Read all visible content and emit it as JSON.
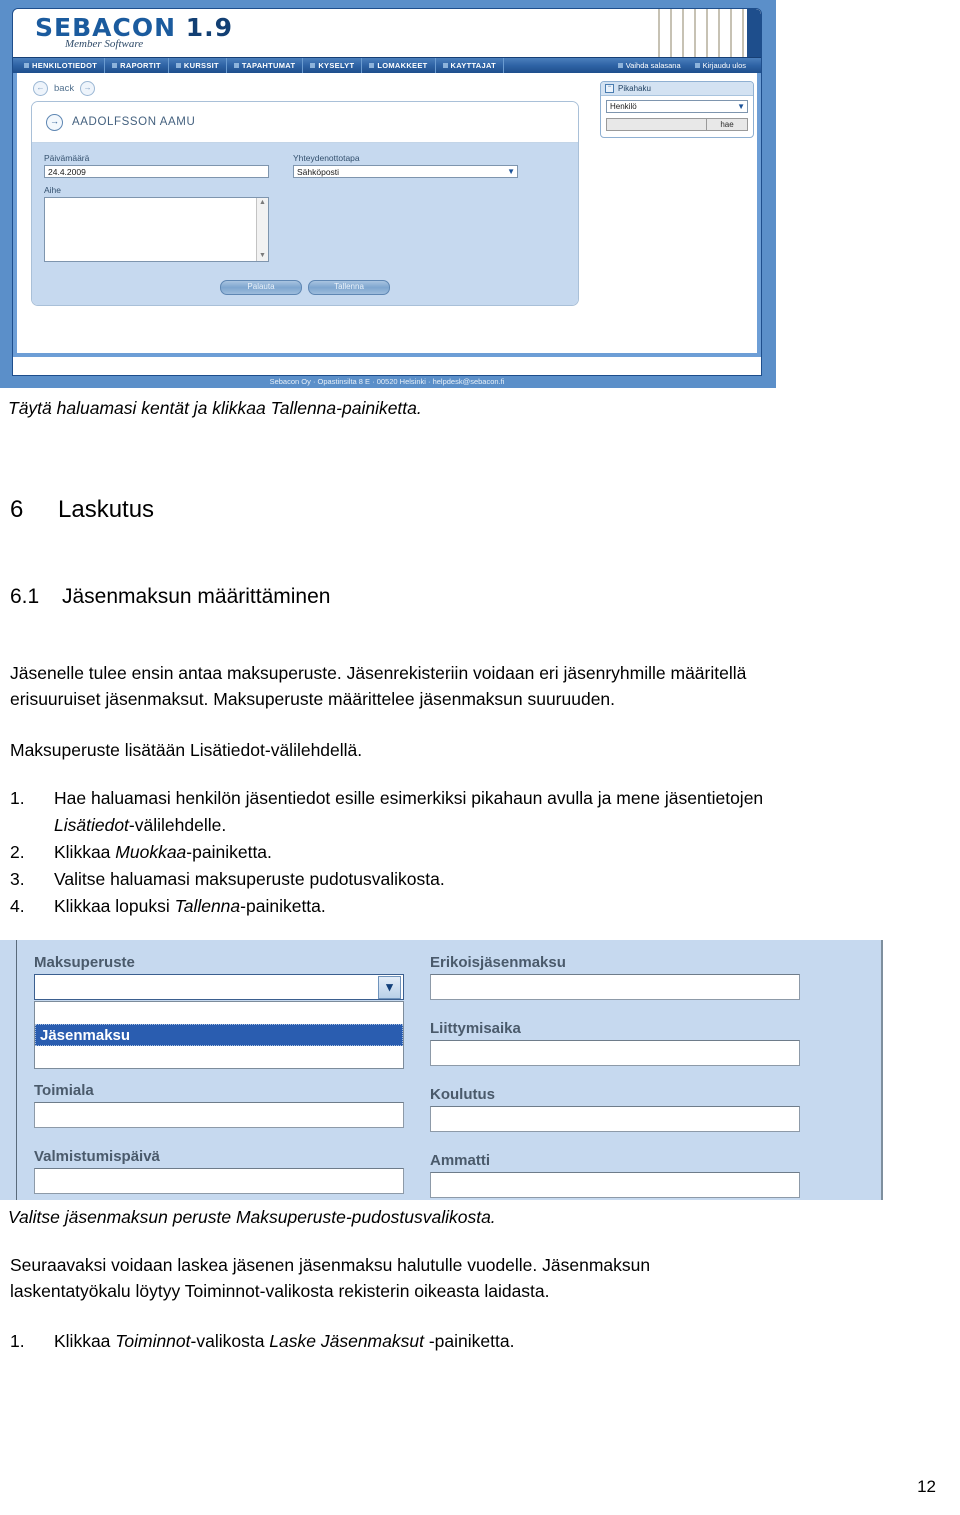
{
  "screenshot1": {
    "brand": {
      "name": "SEBACON",
      "version": "1.9",
      "tagline": "Member Software"
    },
    "nav_left": [
      "HENKILOTIEDOT",
      "RAPORTIT",
      "KURSSIT",
      "TAPAHTUMAT",
      "KYSELYT",
      "LOMAKKEET",
      "KAYTTAJAT"
    ],
    "nav_right": [
      "Vaihda salasana",
      "Kirjaudu ulos"
    ],
    "back_label": "back",
    "panel_title": "AADOLFSSON AAMU",
    "fields": {
      "date_label": "Päivämäärä",
      "date_value": "24.4.2009",
      "contact_label": "Yhteydenottotapa",
      "contact_value": "Sähköposti",
      "subject_label": "Aihe",
      "subject_value": ""
    },
    "buttons": {
      "reset": "Palauta",
      "save": "Tallenna"
    },
    "quicksearch": {
      "title": "Pikahaku",
      "type_value": "Henkilö",
      "query_value": "",
      "go_label": "hae"
    },
    "footer": "Sebacon Oy · Opastinsilta 8 E · 00520 Helsinki · helpdesk@sebacon.fi"
  },
  "caption1": "Täytä haluamasi kentät ja klikkaa Tallenna-painiketta.",
  "heading_6": {
    "number": "6",
    "text": "Laskutus"
  },
  "heading_61": {
    "number": "6.1",
    "text": "Jäsenmaksun määrittäminen"
  },
  "para1_line1": "Jäsenelle tulee ensin antaa maksuperuste. Jäsenrekisteriin voidaan eri jäsenryhmille määritellä",
  "para1_line2": "erisuuruiset jäsenmaksut. Maksuperuste määrittelee jäsenmaksun suuruuden.",
  "para2": "Maksuperuste lisätään Lisätiedot-välilehdellä.",
  "steps1": [
    {
      "num": "1.",
      "a": "Hae haluamasi henkilön jäsentiedot esille esimerkiksi pikahaun avulla ja mene jäsentietojen",
      "b_em": "Lisätiedot",
      "b": "-välilehdelle."
    },
    {
      "num": "2.",
      "a": "Klikkaa ",
      "b_em": "Muokkaa",
      "b": "-painiketta."
    },
    {
      "num": "3.",
      "a": "Valitse haluamasi maksuperuste pudotusvalikosta.",
      "b_em": "",
      "b": ""
    },
    {
      "num": "4.",
      "a": "Klikkaa lopuksi ",
      "b_em": "Tallenna",
      "b": "-painiketta."
    }
  ],
  "screenshot2": {
    "left": [
      {
        "label": "Maksuperuste",
        "type": "select",
        "value": ""
      },
      {
        "label": "Toimiala",
        "type": "text",
        "value": ""
      },
      {
        "label": "Valmistumispäivä",
        "type": "text",
        "value": ""
      }
    ],
    "right": [
      {
        "label": "Erikoisjäsenmaksu",
        "type": "text",
        "value": ""
      },
      {
        "label": "Liittymisaika",
        "type": "text",
        "value": ""
      },
      {
        "label": "Koulutus",
        "type": "text",
        "value": ""
      },
      {
        "label": "Ammatti",
        "type": "text",
        "value": ""
      }
    ],
    "dropdown_options": [
      "",
      "Jäsenmaksu",
      ""
    ],
    "dropdown_selected": "Jäsenmaksu",
    "highlight_color": "#2a5db0"
  },
  "caption2": "Valitse jäsenmaksun peruste Maksuperuste-pudostusvalikosta.",
  "para3_line1": "Seuraavaksi voidaan laskea jäsenen jäsenmaksu halutulle vuodelle. Jäsenmaksun",
  "para3_line2": "laskentatyökalu löytyy Toiminnot-valikosta rekisterin oikeasta laidasta.",
  "steps2": [
    {
      "num": "1.",
      "a": "Klikkaa ",
      "b_em": "Toiminnot",
      "b": "-valikosta ",
      "c_em": "Laske Jäsenmaksut",
      "c": " -painiketta."
    }
  ],
  "page_number": "12"
}
